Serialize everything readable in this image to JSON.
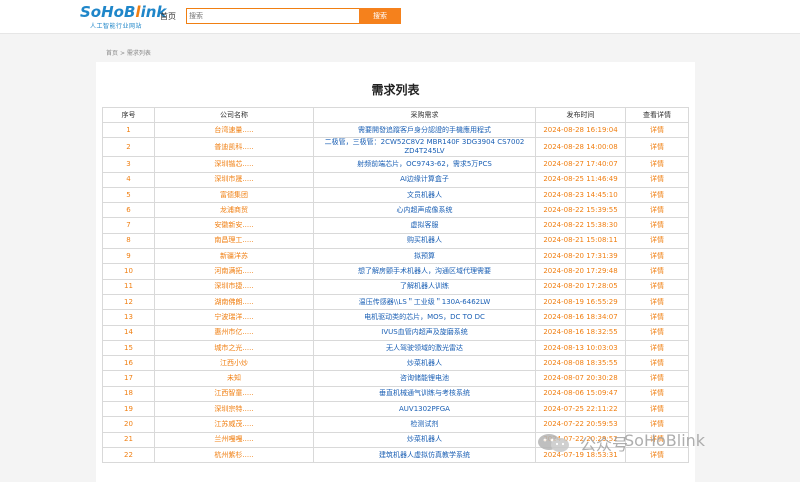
{
  "header": {
    "logo": {
      "text_main": "SoHoB",
      "text_accent": "l",
      "text_tail": "ink",
      "subtitle": "人工智能行业网站"
    },
    "nav_home": "首页",
    "search": {
      "placeholder": "搜索",
      "button_label": "搜索"
    },
    "colors": {
      "brand_blue": "#1f86c9",
      "accent_orange": "#f07f12"
    }
  },
  "breadcrumb": {
    "home": "首页",
    "separator": ">",
    "current": "需求列表"
  },
  "page_title": "需求列表",
  "table": {
    "headers": [
      "序号",
      "公司名称",
      "采购需求",
      "发布时间",
      "查看详情"
    ],
    "rows": [
      {
        "no": "1",
        "company": "台湾速量.....",
        "need": "需要開發追蹤客戶身分認證的手機應用程式",
        "time": "2024-08-28 16:19:04",
        "detail": "详情"
      },
      {
        "no": "2",
        "company": "普迪凯科.....",
        "need": "二极管，三极管：2CW52C8V2 MBR140F 3DG3904 CS7002 ZD4T245LV",
        "time": "2024-08-28 14:00:08",
        "detail": "详情"
      },
      {
        "no": "3",
        "company": "深圳锴芯.....",
        "need": "射频前端芯片，OC9743-62，需求5万PCS",
        "time": "2024-08-27 17:40:07",
        "detail": "详情"
      },
      {
        "no": "4",
        "company": "深圳市晟.....",
        "need": "AI边缘计算盒子",
        "time": "2024-08-25 11:46:49",
        "detail": "详情"
      },
      {
        "no": "5",
        "company": "富德集团",
        "need": "文员机器人",
        "time": "2024-08-23 14:45:10",
        "detail": "详情"
      },
      {
        "no": "6",
        "company": "龙浦商贸",
        "need": "心内超声成像系统",
        "time": "2024-08-22 15:39:55",
        "detail": "详情"
      },
      {
        "no": "7",
        "company": "安徽新安.....",
        "need": "虚拟客服",
        "time": "2024-08-22 15:38:30",
        "detail": "详情"
      },
      {
        "no": "8",
        "company": "南昌理工.....",
        "need": "购买机器人",
        "time": "2024-08-21 15:08:11",
        "detail": "详情"
      },
      {
        "no": "9",
        "company": "新疆洋苏",
        "need": "拟预算",
        "time": "2024-08-20 17:31:39",
        "detail": "详情"
      },
      {
        "no": "10",
        "company": "河南满拓.....",
        "need": "想了解房颤手术机器人，沟通区域代理需要",
        "time": "2024-08-20 17:29:48",
        "detail": "详情"
      },
      {
        "no": "11",
        "company": "深圳市捷.....",
        "need": "了解机器人训练",
        "time": "2024-08-20 17:28:05",
        "detail": "详情"
      },
      {
        "no": "12",
        "company": "湖南佛朗.....",
        "need": "温压传感器\\\\LS＂工业级＂130A-6462LW",
        "time": "2024-08-19 16:55:29",
        "detail": "详情"
      },
      {
        "no": "13",
        "company": "宁波瑞洋.....",
        "need": "电机驱动类的芯片，MOS，DC TO DC",
        "time": "2024-08-16 18:34:07",
        "detail": "详情"
      },
      {
        "no": "14",
        "company": "惠州市亿.....",
        "need": "IVUS血管内超声及旋磨系统",
        "time": "2024-08-16 18:32:55",
        "detail": "详情"
      },
      {
        "no": "15",
        "company": "城市之光.....",
        "need": "无人驾驶领域的激光雷达",
        "time": "2024-08-13 10:03:03",
        "detail": "详情"
      },
      {
        "no": "16",
        "company": "江西小炒",
        "need": "炒菜机器人",
        "time": "2024-08-08 18:35:55",
        "detail": "详情"
      },
      {
        "no": "17",
        "company": "未知",
        "need": "咨询储能锂电池",
        "time": "2024-08-07 20:30:28",
        "detail": "详情"
      },
      {
        "no": "18",
        "company": "江西智童.....",
        "need": "垂直机械通气训练与考核系统",
        "time": "2024-08-06 15:09:47",
        "detail": "详情"
      },
      {
        "no": "19",
        "company": "深圳宗特.....",
        "need": "AUV1302PFGA",
        "time": "2024-07-25 22:11:22",
        "detail": "详情"
      },
      {
        "no": "20",
        "company": "江苏威茂.....",
        "need": "检测试剂",
        "time": "2024-07-22 20:59:53",
        "detail": "详情"
      },
      {
        "no": "21",
        "company": "兰州嘎嘎.....",
        "need": "炒菜机器人",
        "time": "2024-07-22 20:29:52",
        "detail": "详情"
      },
      {
        "no": "22",
        "company": "杭州紫杉.....",
        "need": "建筑机器人虚拟仿真教学系统",
        "time": "2024-07-19 18:53:31",
        "detail": "详情"
      }
    ]
  },
  "watermark": {
    "text": "公众号 · SoHoBlink",
    "label": "公众号",
    "brand": "SoHoBlink",
    "icon": "wechat-icon"
  }
}
